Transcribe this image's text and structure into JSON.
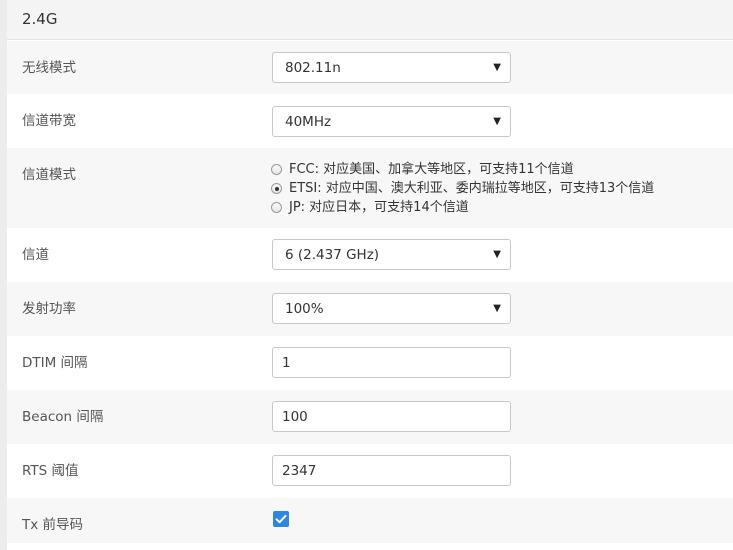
{
  "panel": {
    "title": "2.4G"
  },
  "rows": {
    "wireless_mode": {
      "label": "无线模式",
      "value": "802.11n"
    },
    "bandwidth": {
      "label": "信道带宽",
      "value": "40MHz"
    },
    "channel_mode": {
      "label": "信道模式",
      "options": [
        {
          "text": "FCC: 对应美国、加拿大等地区，可支持11个信道",
          "checked": false
        },
        {
          "text": "ETSI: 对应中国、澳大利亚、委内瑞拉等地区，可支持13个信道",
          "checked": true
        },
        {
          "text": "JP: 对应日本，可支持14个信道",
          "checked": false
        }
      ]
    },
    "channel": {
      "label": "信道",
      "value": "6 (2.437 GHz)"
    },
    "tx_power": {
      "label": "发射功率",
      "value": "100%"
    },
    "dtim": {
      "label": "DTIM 间隔",
      "value": "1"
    },
    "beacon": {
      "label": "Beacon 间隔",
      "value": "100"
    },
    "rts": {
      "label": "RTS 阈值",
      "value": "2347"
    },
    "tx_preamble": {
      "label": "Tx 前导码",
      "checked": true
    }
  },
  "icons": {
    "caret": "caret-down-icon",
    "check": "check-icon"
  },
  "colors": {
    "checkbox_accent": "#2e86de",
    "row_shade": "#f7f7f7"
  }
}
